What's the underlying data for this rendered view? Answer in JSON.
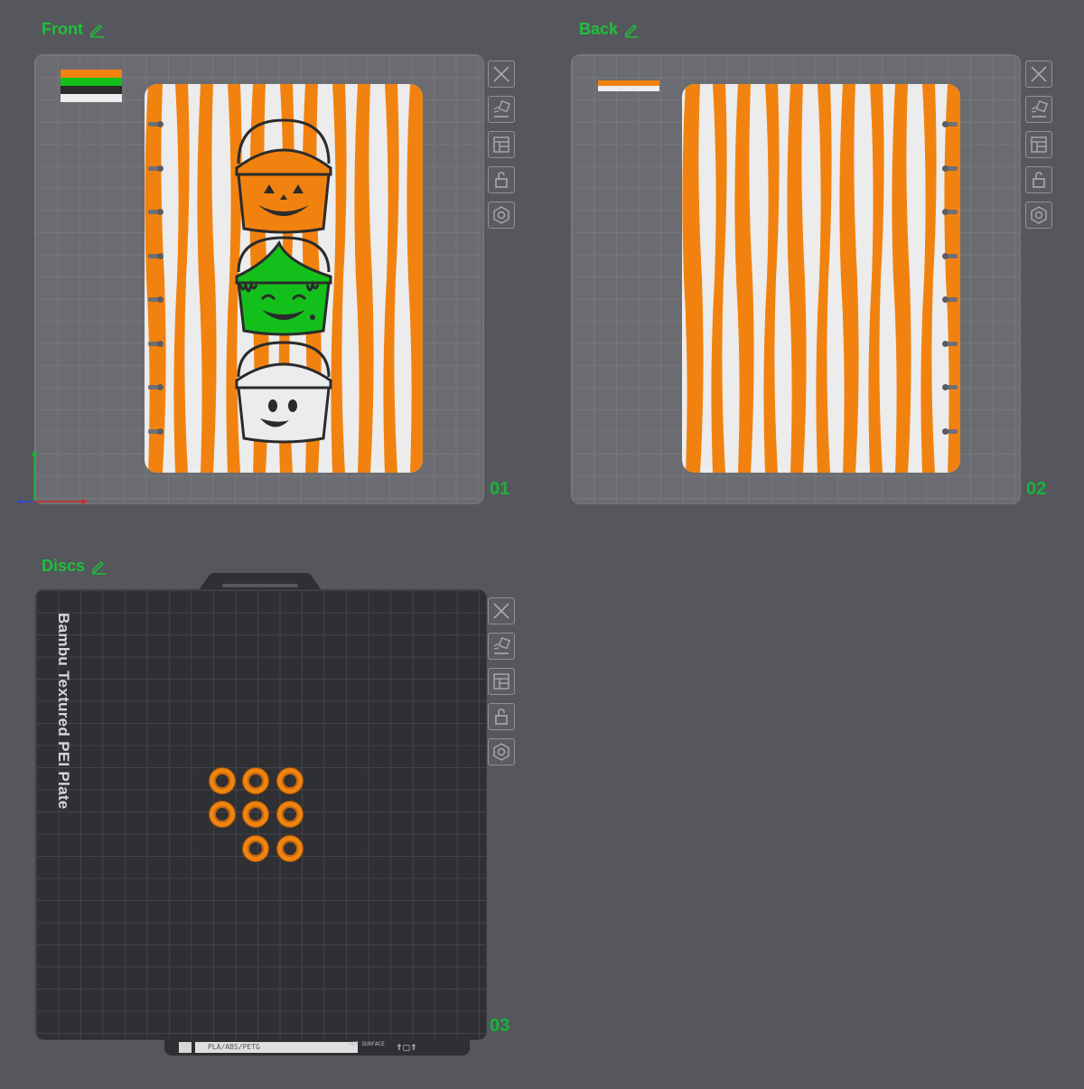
{
  "plates": [
    {
      "title": "Front",
      "number": "01",
      "edit_icon": "pencil-edit-icon"
    },
    {
      "title": "Back",
      "number": "02",
      "edit_icon": "pencil-edit-icon"
    },
    {
      "title": "Discs",
      "number": "03",
      "edit_icon": "pencil-edit-icon"
    }
  ],
  "toolbar": {
    "close": "close-icon",
    "arrange": "auto-arrange-icon",
    "orient": "auto-orient-icon",
    "lock": "lock-icon",
    "settings": "plate-settings-icon"
  },
  "textured_plate": {
    "name": "Bambu Textured PEI Plate",
    "badge_text": "PLA/ABS/PETG",
    "hot_text": "HOT SURFACE"
  },
  "colors": {
    "accent_green": "#1fbf3a",
    "orange": "#f2820f",
    "white": "#ececec",
    "green": "#13c01b",
    "black": "#2b2b2b"
  },
  "filament_swatches_front": [
    "#f2820f",
    "#13c01b",
    "#2b2b2b",
    "#ececec"
  ],
  "filament_swatches_back": [
    "#f2820f",
    "#ececec"
  ],
  "disc_count": 8
}
